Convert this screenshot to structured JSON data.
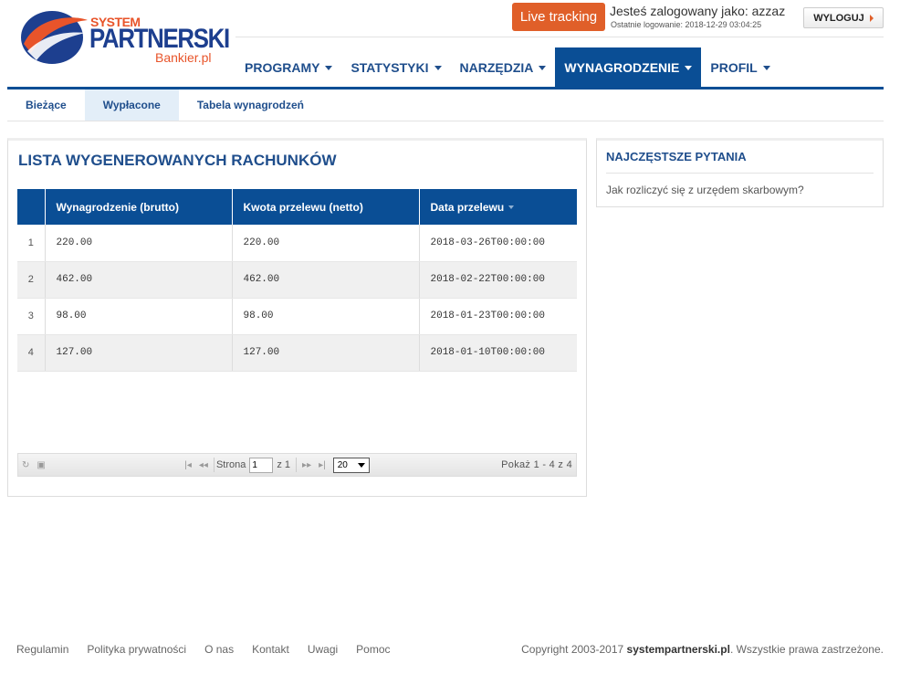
{
  "logo": {
    "line1": "SYSTEM",
    "line2": "PARTNERSKI",
    "line3": "Bankier.pl"
  },
  "header": {
    "live_tracking": "Live tracking",
    "logged_as": "Jesteś zalogowany jako: azzaz",
    "last_login": "Ostatnie logowanie: 2018-12-29 03:04:25",
    "logout": "WYLOGUJ"
  },
  "nav": {
    "items": [
      {
        "label": "PROGRAMY"
      },
      {
        "label": "STATYSTYKI"
      },
      {
        "label": "NARZĘDZIA"
      },
      {
        "label": "WYNAGRODZENIE"
      },
      {
        "label": "PROFIL"
      }
    ],
    "active": "WYNAGRODZENIE"
  },
  "subnav": {
    "items": [
      {
        "label": "Bieżące"
      },
      {
        "label": "Wypłacone"
      },
      {
        "label": "Tabela wynagrodzeń"
      }
    ],
    "active": "Wypłacone"
  },
  "main": {
    "title": "LISTA WYGENEROWANYCH RACHUNKÓW",
    "columns": [
      "",
      "Wynagrodzenie (brutto)",
      "Kwota przelewu (netto)",
      "Data przelewu"
    ],
    "rows": [
      {
        "n": "1",
        "brutto": "220.00",
        "netto": "220.00",
        "date": "2018-03-26T00:00:00"
      },
      {
        "n": "2",
        "brutto": "462.00",
        "netto": "462.00",
        "date": "2018-02-22T00:00:00"
      },
      {
        "n": "3",
        "brutto": "98.00",
        "netto": "98.00",
        "date": "2018-01-23T00:00:00"
      },
      {
        "n": "4",
        "brutto": "127.00",
        "netto": "127.00",
        "date": "2018-01-10T00:00:00"
      }
    ],
    "pager": {
      "page_label": "Strona",
      "page_value": "1",
      "of_label": "z 1",
      "rows_per_page": "20",
      "info": "Pokaż 1 - 4 z 4"
    }
  },
  "faq": {
    "title": "NAJCZĘSTSZE PYTANIA",
    "items": [
      "Jak rozliczyć się z urzędem skarbowym?"
    ]
  },
  "footer": {
    "links": [
      "Regulamin",
      "Polityka prywatności",
      "O nas",
      "Kontakt",
      "Uwagi",
      "Pomoc"
    ],
    "copyright_prefix": "Copyright 2003-2017 ",
    "copyright_site": "systempartnerski.pl",
    "copyright_suffix": ". Wszystkie prawa zastrzeżone."
  },
  "colors": {
    "brand_blue": "#0a4e95",
    "accent_orange": "#e05f29",
    "link_blue": "#1f4e8c"
  }
}
